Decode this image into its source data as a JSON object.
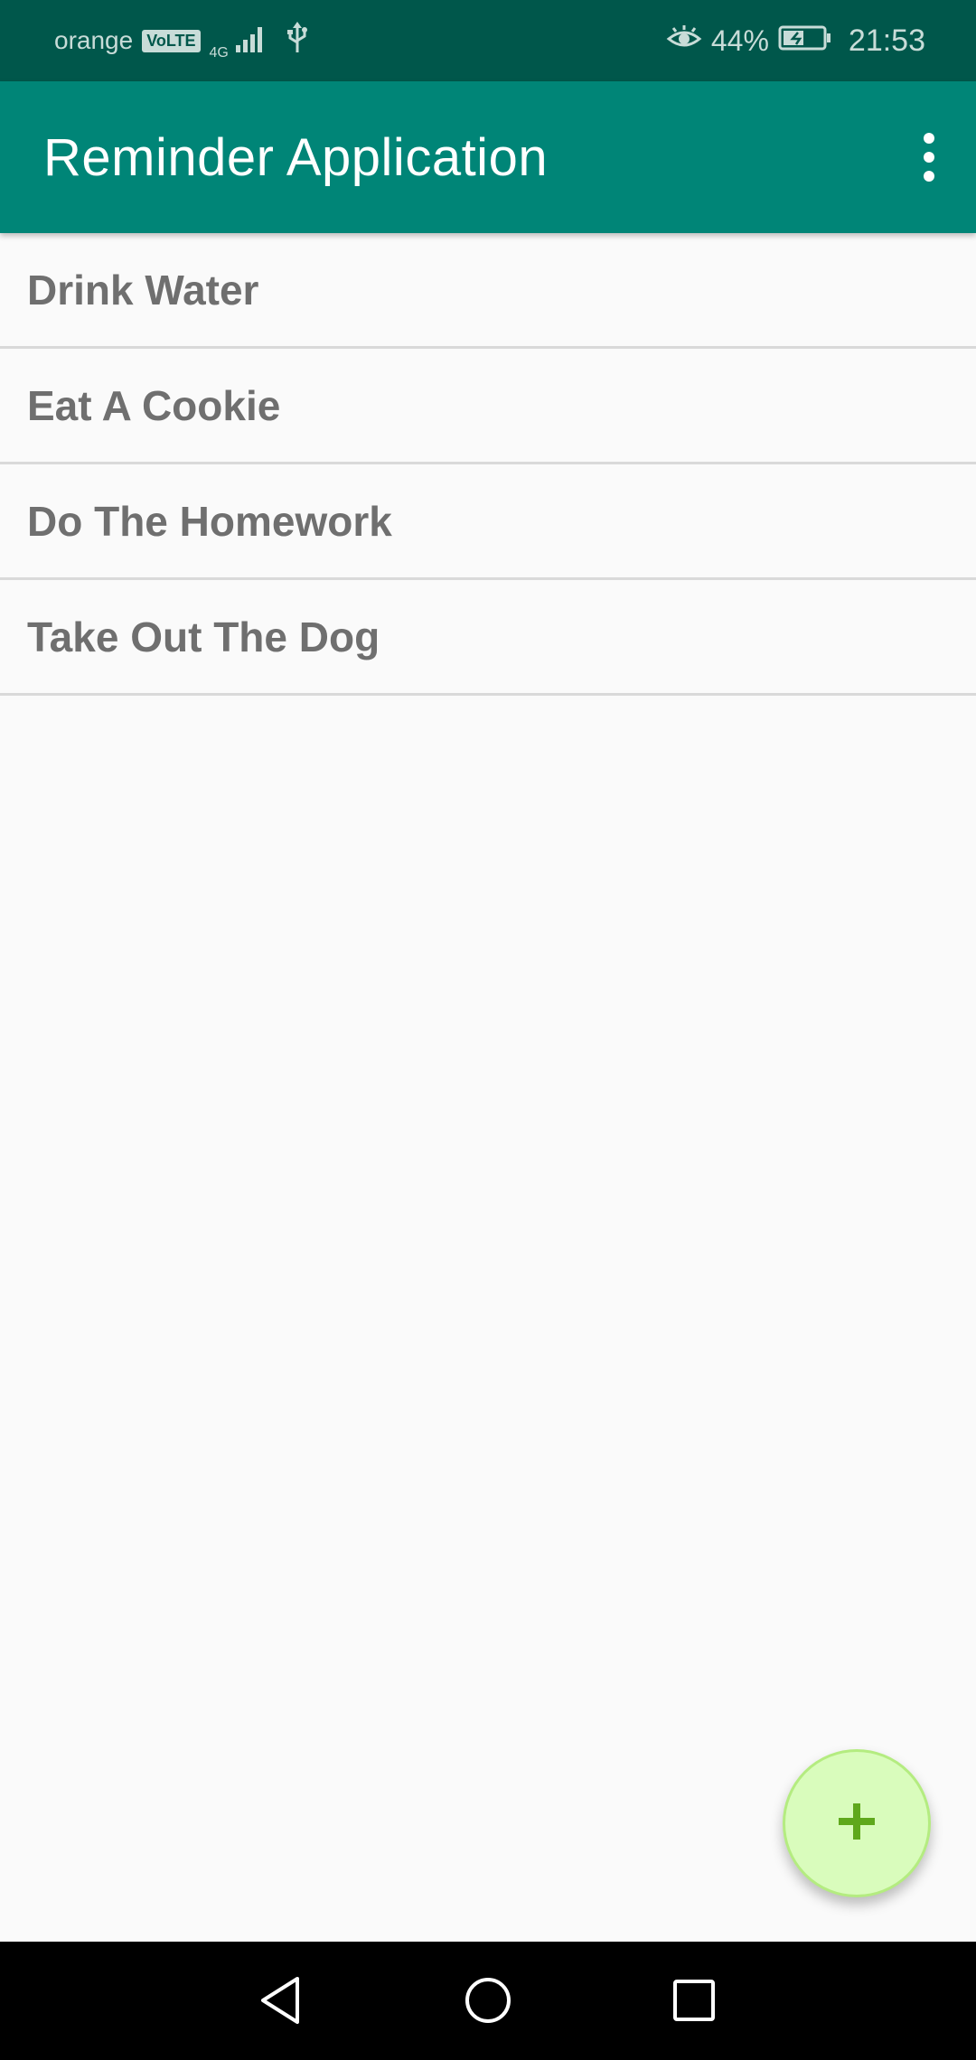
{
  "status_bar": {
    "carrier": "orange",
    "volte": "VoLTE",
    "network_type": "4G",
    "battery_percent": "44%",
    "time": "21:53",
    "icons": [
      "volte-icon",
      "signal-icon",
      "usb-icon",
      "eye-comfort-icon",
      "battery-charging-icon"
    ]
  },
  "app_bar": {
    "title": "Reminder Application",
    "menu_icon": "overflow-menu-icon"
  },
  "reminders": [
    {
      "label": "Drink Water"
    },
    {
      "label": "Eat A Cookie"
    },
    {
      "label": "Do The Homework"
    },
    {
      "label": "Take Out The Dog"
    }
  ],
  "fab": {
    "icon": "plus-icon"
  },
  "nav_bar": {
    "icons": [
      "back-icon",
      "home-icon",
      "recents-icon"
    ]
  },
  "colors": {
    "status_bar": "#00574b",
    "app_bar": "#008577",
    "background": "#fafafa",
    "list_text": "#6f6f6f",
    "divider": "#d9d9d9",
    "fab_fill": "#d9fcbc",
    "fab_icon": "#5fa81c",
    "nav_bar": "#000000"
  }
}
